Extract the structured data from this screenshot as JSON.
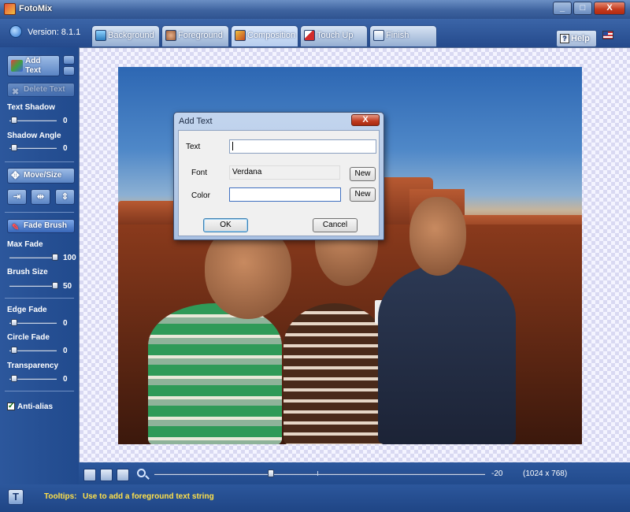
{
  "window": {
    "title": "FotoMix",
    "minimize": "_",
    "maximize": "□",
    "close": "X"
  },
  "header": {
    "version": "Version: 8.1.1",
    "tabs": [
      {
        "label": "Background",
        "icon": "picture-icon"
      },
      {
        "label": "Foreground",
        "icon": "person-icon"
      },
      {
        "label": "Composition",
        "icon": "composition-icon"
      },
      {
        "label": "Touch Up",
        "icon": "brush-icon"
      },
      {
        "label": "Finish",
        "icon": "finish-icon"
      }
    ],
    "active_tab": "Composition",
    "help": "Help",
    "help_icon": "?"
  },
  "left": {
    "add_text": "Add Text",
    "delete_text": "Delete Text",
    "text_shadow": {
      "label": "Text Shadow",
      "value": "0"
    },
    "shadow_angle": {
      "label": "Shadow Angle",
      "value": "0"
    },
    "move_size": "Move/Size",
    "fade_brush": "Fade Brush",
    "max_fade": {
      "label": "Max Fade",
      "value": "100"
    },
    "brush_size": {
      "label": "Brush Size",
      "value": "50"
    },
    "edge_fade": {
      "label": "Edge Fade",
      "value": "0"
    },
    "circle_fade": {
      "label": "Circle Fade",
      "value": "0"
    },
    "transparency": {
      "label": "Transparency",
      "value": "0"
    },
    "anti_alias": {
      "label": "Anti-alias",
      "checked": true
    }
  },
  "dialog": {
    "title": "Add Text",
    "close": "X",
    "text_label": "Text",
    "text_value": "",
    "font_label": "Font",
    "font_value": "Verdana",
    "new_font": "New",
    "color_label": "Color",
    "new_color": "New",
    "ok": "OK",
    "cancel": "Cancel"
  },
  "bottom": {
    "zoom_value": "-20",
    "image_size": "(1024 x 768)"
  },
  "status": {
    "tooltip_label": "Tooltips:",
    "tooltip_text": "Use to add a foreground text string",
    "t_icon": "T"
  }
}
